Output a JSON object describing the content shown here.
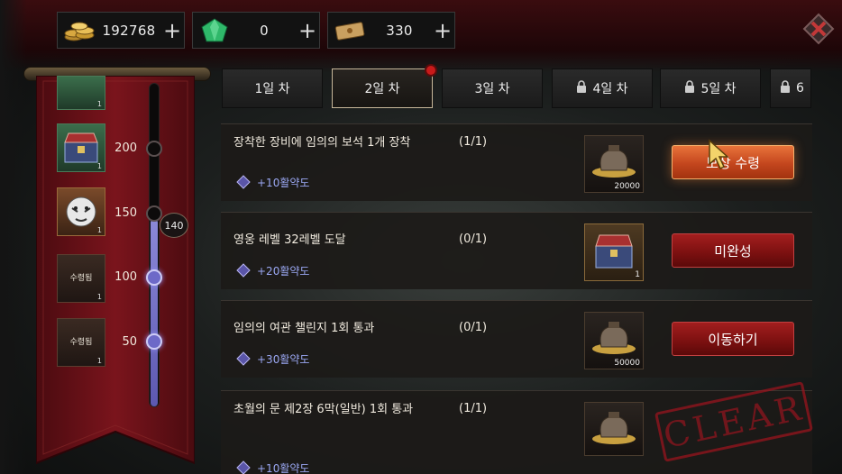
{
  "currencies": {
    "gold": {
      "icon": "gold-coin-icon",
      "amount": "192768"
    },
    "gem": {
      "icon": "emerald-gem-icon",
      "amount": "0"
    },
    "ticket": {
      "icon": "ticket-icon",
      "amount": "330"
    },
    "plus": "+"
  },
  "tabs": [
    {
      "label": "1일 차",
      "locked": false,
      "active": false
    },
    {
      "label": "2일 차",
      "locked": false,
      "active": true,
      "notification": true
    },
    {
      "label": "3일 차",
      "locked": false,
      "active": false
    },
    {
      "label": "4일 차",
      "locked": true,
      "active": false
    },
    {
      "label": "5일 차",
      "locked": true,
      "active": false
    },
    {
      "label": "6",
      "locked": true,
      "active": false
    }
  ],
  "milestones": {
    "current_points": "140",
    "progress_value": 140,
    "nodes": [
      {
        "value": "200",
        "reached": false,
        "reward_qty": "1",
        "claimed": false
      },
      {
        "value": "150",
        "reached": false,
        "reward_qty": "1",
        "claimed": false
      },
      {
        "value": "100",
        "reached": true,
        "reward_qty": "1",
        "claimed": true,
        "claimed_label": "수령됨"
      },
      {
        "value": "50",
        "reached": true,
        "reward_qty": "1",
        "claimed": true,
        "claimed_label": "수령됨"
      }
    ],
    "top_partial_qty": "1"
  },
  "quests": [
    {
      "title": "장착한 장비에 임의의 보석 1개 장착",
      "count": "(1/1)",
      "points": "+10활약도",
      "reward_qty": "20000",
      "button": "보상 수령",
      "button_state": "claim"
    },
    {
      "title": "영웅 레벨 32레벨 도달",
      "count": "(0/1)",
      "points": "+20활약도",
      "reward_qty": "1",
      "button": "미완성",
      "button_state": "incomplete"
    },
    {
      "title": "임의의 여관 챌린지 1회 통과",
      "count": "(0/1)",
      "points": "+30활약도",
      "reward_qty": "50000",
      "button": "이동하기",
      "button_state": "move"
    },
    {
      "title": "초월의 문 제2장 6막(일반) 1회 통과",
      "count": "(1/1)",
      "points": "+10활약도",
      "reward_qty": "",
      "stamp": "CLEAR"
    }
  ]
}
